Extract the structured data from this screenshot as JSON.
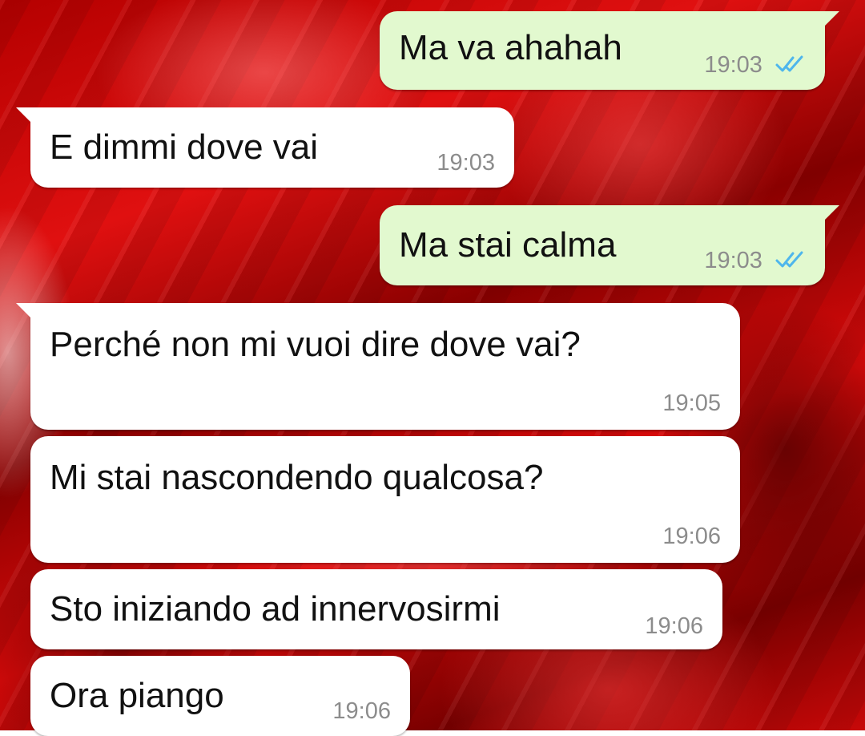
{
  "chat": {
    "messages": [
      {
        "direction": "outgoing",
        "text": "Ma va ahahah",
        "time": "19:03",
        "status": "read"
      },
      {
        "direction": "incoming",
        "text": "E dimmi dove vai",
        "time": "19:03"
      },
      {
        "direction": "outgoing",
        "text": "Ma stai calma",
        "time": "19:03",
        "status": "read"
      },
      {
        "direction": "incoming",
        "text": "Perché non mi vuoi dire dove vai?",
        "time": "19:05"
      },
      {
        "direction": "incoming",
        "text": "Mi stai nascondendo qualcosa?",
        "time": "19:06"
      },
      {
        "direction": "incoming",
        "text": "Sto iniziando ad innervosirmi",
        "time": "19:06"
      },
      {
        "direction": "incoming",
        "text": "Ora piango",
        "time": "19:06"
      }
    ]
  },
  "colors": {
    "wallpaper": "#c80808",
    "incoming_bubble": "#ffffff",
    "outgoing_bubble": "#e2f9cf",
    "read_ticks": "#4fb6ec",
    "timestamp": "#8c8c8c"
  },
  "icons": {
    "read_status": "double-check-icon"
  }
}
